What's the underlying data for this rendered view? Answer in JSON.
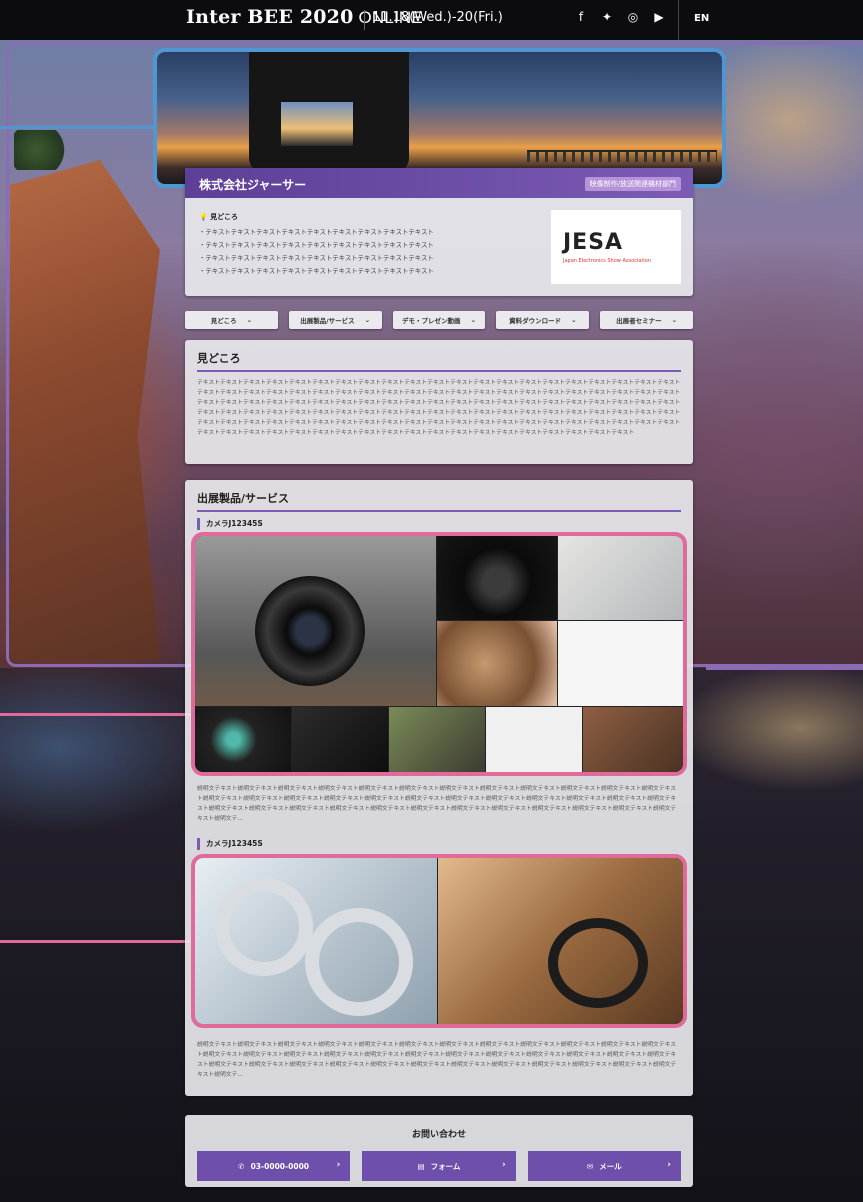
{
  "topbar": {
    "title_main": "Inter BEE 2020",
    "title_suffix": " ONLINE",
    "dates": "11.18(Wed.)-20(Fri.)",
    "social": [
      "facebook-icon",
      "twitter-icon",
      "instagram-icon",
      "youtube-icon"
    ],
    "social_glyphs": [
      "f",
      "🐦",
      "◎",
      "▶"
    ],
    "lang": "EN"
  },
  "company": {
    "name": "株式会社ジャーサー",
    "category": "映像制作/放送関連機材部門",
    "highlight_label": "見どころ",
    "highlights": [
      "・テキストテキストテキストテキストテキストテキストテキストテキストテキスト",
      "・テキストテキストテキストテキストテキストテキストテキストテキストテキスト",
      "・テキストテキストテキストテキストテキストテキストテキストテキストテキスト",
      "・テキストテキストテキストテキストテキストテキストテキストテキストテキスト"
    ],
    "logo_text": "JESA",
    "logo_sub": "Japan Electronics Show Association"
  },
  "tabs": [
    {
      "label": "見どころ"
    },
    {
      "label": "出展製品/サービス"
    },
    {
      "label": "デモ・プレゼン動画"
    },
    {
      "label": "資料ダウンロード"
    },
    {
      "label": "出展者セミナー"
    }
  ],
  "midokoro": {
    "title": "見どころ",
    "text": "テキストテキストテキストテキストテキストテキストテキストテキストテキストテキストテキストテキストテキストテキストテキストテキストテキストテキストテキストテキストテキストテキストテキストテキストテキストテキストテキストテキストテキストテキストテキストテキストテキストテキストテキストテキストテキストテキストテキストテキストテキストテキストテキストテキストテキストテキストテキストテキストテキストテキストテキストテキストテキストテキストテキストテキストテキストテキストテキストテキストテキストテキストテキストテキストテキストテキストテキストテキストテキストテキストテキストテキストテキストテキストテキストテキストテキストテキストテキストテキストテキストテキストテキストテキストテキストテキストテキストテキストテキストテキストテキストテキストテキストテキストテキストテキストテキストテキストテキストテキストテキストテキストテキストテキストテキストテキストテキストテキストテキストテキストテキストテキストテキストテキストテキストテキストテキストテキストテキストテキストテキストテキストテキストテキスト"
  },
  "products": {
    "title": "出展製品/サービス",
    "items": [
      {
        "name": "カメラJ12345S",
        "description": "説明文テキスト説明文テキスト説明文テキスト説明文テキスト説明文テキスト説明文テキスト説明文テキスト説明文テキスト説明文テキスト説明文テキスト説明文テキスト説明文テキスト説明文テキスト説明文テキスト説明文テキスト説明文テキスト説明文テキスト説明文テキスト説明文テキスト説明文テキスト説明文テキスト説明文テキスト説明文テキスト説明文テキスト説明文テキスト説明文テキスト説明文テキスト説明文テキスト説明文テキスト説明文テキスト説明文テキスト説明文テキスト説明文テキスト説明文テキスト説明文テキスト説明文テキスト説明文テ..."
      },
      {
        "name": "カメラJ12345S",
        "description": "説明文テキスト説明文テキスト説明文テキスト説明文テキスト説明文テキスト説明文テキスト説明文テキスト説明文テキスト説明文テキスト説明文テキスト説明文テキスト説明文テキスト説明文テキスト説明文テキスト説明文テキスト説明文テキスト説明文テキスト説明文テキスト説明文テキスト説明文テキスト説明文テキスト説明文テキスト説明文テキスト説明文テキスト説明文テキスト説明文テキスト説明文テキスト説明文テキスト説明文テキスト説明文テキスト説明文テキスト説明文テキスト説明文テキスト説明文テキスト説明文テキスト説明文テキスト説明文テ..."
      }
    ]
  },
  "contact": {
    "title": "お問い合わせ",
    "phone": "03-0000-0000",
    "form": "フォーム",
    "mail": "メール"
  },
  "colors": {
    "accent_purple": "#6e4fab",
    "annotation_blue": "#4f96d3",
    "annotation_pink": "#e06a9a",
    "annotation_purple": "#8b6bb5"
  }
}
